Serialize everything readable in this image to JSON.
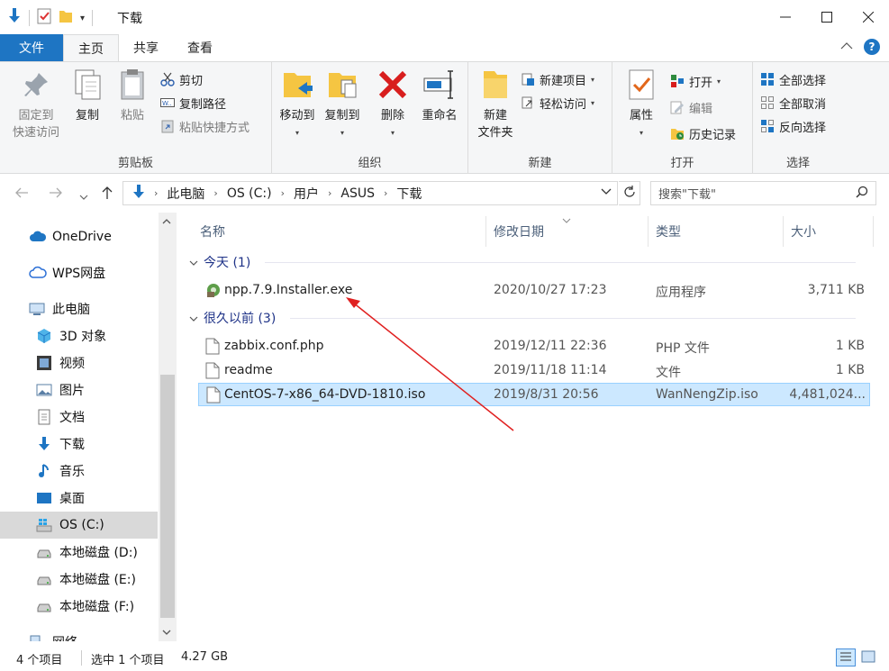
{
  "window": {
    "title": "下载",
    "accent": "#1e75c3"
  },
  "tabs": [
    {
      "label": "文件"
    },
    {
      "label": "主页"
    },
    {
      "label": "共享"
    },
    {
      "label": "查看"
    }
  ],
  "ribbon": {
    "clipboard": {
      "label": "剪贴板",
      "pin_line1": "固定到",
      "pin_line2": "快速访问",
      "copy": "复制",
      "paste": "粘贴",
      "cut": "剪切",
      "copy_path": "复制路径",
      "paste_shortcut": "粘贴快捷方式"
    },
    "organize": {
      "label": "组织",
      "move_to": "移动到",
      "copy_to": "复制到",
      "delete": "删除",
      "rename": "重命名"
    },
    "new": {
      "label": "新建",
      "new_folder_line1": "新建",
      "new_folder_line2": "文件夹",
      "new_item": "新建项目",
      "easy_access": "轻松访问"
    },
    "open": {
      "label": "打开",
      "properties": "属性",
      "open": "打开",
      "edit": "编辑",
      "history": "历史记录"
    },
    "select": {
      "label": "选择",
      "select_all": "全部选择",
      "select_none": "全部取消",
      "invert": "反向选择"
    }
  },
  "address": {
    "crumbs": [
      "此电脑",
      "OS (C:)",
      "用户",
      "ASUS",
      "下载"
    ],
    "search_placeholder": "搜索\"下载\""
  },
  "nav": [
    {
      "label": "OneDrive",
      "icon": "cloud-icon"
    },
    {
      "label": "WPS网盘",
      "icon": "cloud-outline-icon"
    },
    {
      "label": "此电脑",
      "icon": "computer-icon"
    },
    {
      "label": "3D 对象",
      "icon": "cube-icon"
    },
    {
      "label": "视频",
      "icon": "film-icon"
    },
    {
      "label": "图片",
      "icon": "picture-icon"
    },
    {
      "label": "文档",
      "icon": "document-icon"
    },
    {
      "label": "下载",
      "icon": "download-arrow-icon"
    },
    {
      "label": "音乐",
      "icon": "music-note-icon"
    },
    {
      "label": "桌面",
      "icon": "desktop-icon"
    },
    {
      "label": "OS (C:)",
      "icon": "windows-drive-icon"
    },
    {
      "label": "本地磁盘 (D:)",
      "icon": "drive-icon"
    },
    {
      "label": "本地磁盘 (E:)",
      "icon": "drive-icon"
    },
    {
      "label": "本地磁盘 (F:)",
      "icon": "drive-icon"
    },
    {
      "label": "网络",
      "icon": "network-icon"
    }
  ],
  "columns": {
    "name": "名称",
    "date": "修改日期",
    "type": "类型",
    "size": "大小"
  },
  "groups": {
    "today": {
      "label": "今天 (1)"
    },
    "long_ago": {
      "label": "很久以前 (3)"
    }
  },
  "files": [
    {
      "name": "npp.7.9.Installer.exe",
      "date": "2020/10/27 17:23",
      "type": "应用程序",
      "size": "3,711 KB"
    },
    {
      "name": "zabbix.conf.php",
      "date": "2019/12/11 22:36",
      "type": "PHP 文件",
      "size": "1 KB"
    },
    {
      "name": "readme",
      "date": "2019/11/18 11:14",
      "type": "文件",
      "size": "1 KB"
    },
    {
      "name": "CentOS-7-x86_64-DVD-1810.iso",
      "date": "2019/8/31 20:56",
      "type": "WanNengZip.iso",
      "size": "4,481,024..."
    }
  ],
  "status": {
    "count": "4 个项目",
    "selected": "选中 1 个项目",
    "selected_size": "4.27 GB"
  }
}
